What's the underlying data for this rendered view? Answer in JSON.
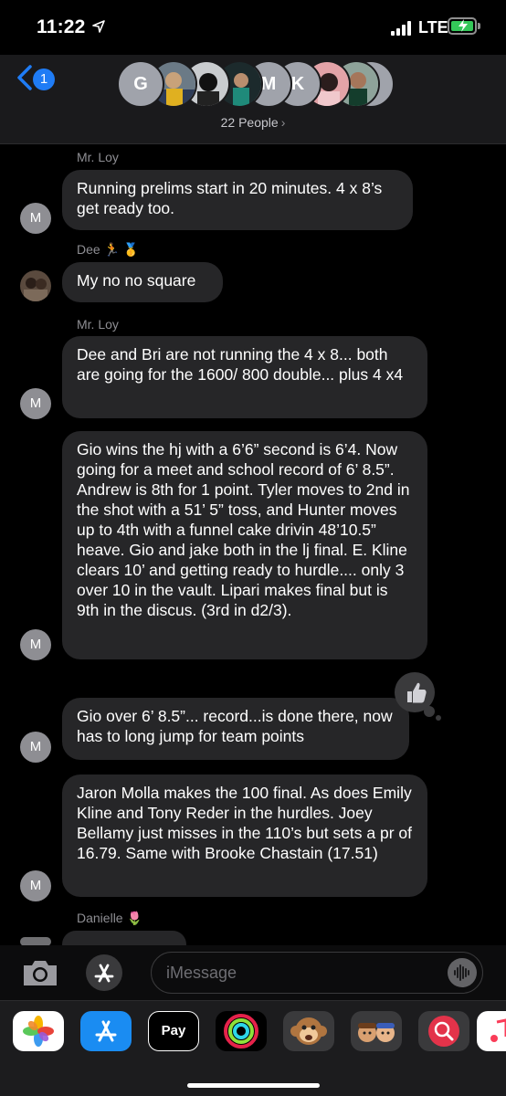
{
  "status": {
    "time": "11:22",
    "network": "LTE"
  },
  "header": {
    "back_badge": "1",
    "people_label": "22 People",
    "avatars": [
      {
        "kind": "letter",
        "text": "G"
      },
      {
        "kind": "photo",
        "icon": "group-photo-avatar"
      },
      {
        "kind": "photo",
        "icon": "group-photo-avatar"
      },
      {
        "kind": "letter",
        "text": "M"
      },
      {
        "kind": "letter",
        "text": "K"
      },
      {
        "kind": "photo",
        "icon": "group-photo-avatar"
      },
      {
        "kind": "photo",
        "icon": "group-photo-avatar"
      },
      {
        "kind": "letter",
        "text": ""
      }
    ]
  },
  "messages": [
    {
      "sender": "Mr. Loy",
      "avatar_letter": "M",
      "text": "Running prelims start in 20 minutes.  4 x 8’s get ready too."
    },
    {
      "sender": "Dee 🏃 🥇",
      "avatar_letter": "",
      "text": "My no no square"
    },
    {
      "sender": "Mr. Loy",
      "avatar_letter": "M",
      "text": "Dee and Bri are not running the 4 x 8... both are going for the 1600/ 800 double... plus 4 x4"
    },
    {
      "sender": "",
      "avatar_letter": "M",
      "text": "Gio wins the hj with a 6’6” second is 6’4. Now going for a meet and school record of 6’ 8.5”.  Andrew is 8th for 1 point.  Tyler moves to 2nd in the shot with a 51’ 5” toss, and Hunter moves up to 4th with a funnel cake drivin 48’10.5” heave.   Gio and jake both in the lj final.   E. Kline clears 10’ and getting ready to hurdle.... only 3 over 10 in the  vault.  Lipari makes final but is 9th in the discus. (3rd in d2/3)."
    },
    {
      "sender": "",
      "avatar_letter": "M",
      "text": "Gio over 6’ 8.5”... record...is done there, now has to long jump for team points",
      "tapback": "thumbs-up-icon"
    },
    {
      "sender": "",
      "avatar_letter": "M",
      "text": "Jaron Molla makes  the 100 final.  As does Emily Kline and Tony Reder in the hurdles. Joey Bellamy just misses in the 110’s but sets a pr of 16.79.  Same with Brooke Chastain (17.51)"
    },
    {
      "sender": "Danielle 🌷",
      "avatar_letter": "",
      "text": ""
    }
  ],
  "input": {
    "placeholder": "iMessage"
  },
  "apps": [
    {
      "name": "photos-app-icon"
    },
    {
      "name": "app-store-icon"
    },
    {
      "name": "apple-pay-icon",
      "label": "Pay"
    },
    {
      "name": "activity-icon"
    },
    {
      "name": "monkey-memoji-icon"
    },
    {
      "name": "memoji-stickers-icon"
    },
    {
      "name": "web-search-icon"
    },
    {
      "name": "music-icon"
    }
  ],
  "colors": {
    "accent": "#1f7cf5",
    "bubble": "#262628",
    "background": "#000000"
  }
}
